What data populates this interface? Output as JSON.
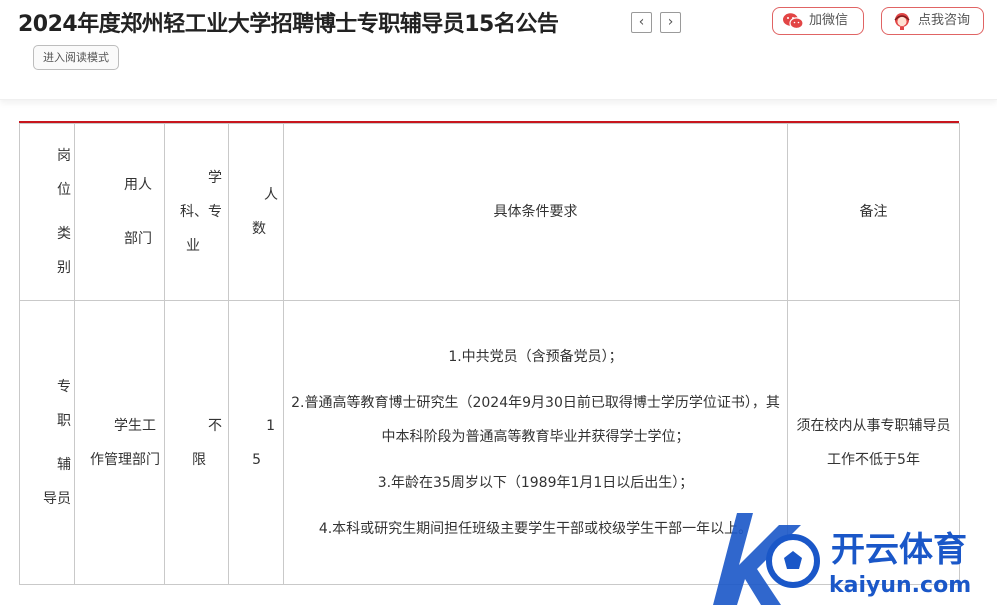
{
  "header": {
    "title": "2024年度郑州轻工业大学招聘博士专职辅导员15名公告",
    "prev_glyph": "‹",
    "next_glyph": "›",
    "reader_mode": "进入阅读模式",
    "wechat_label": "加微信",
    "consult_label": "点我咨询"
  },
  "table": {
    "headers": {
      "category": [
        "岗",
        "位",
        "类",
        "别"
      ],
      "department": [
        "用人",
        "部门"
      ],
      "major": [
        "学",
        "科、专",
        "业"
      ],
      "count": [
        "人",
        "数"
      ],
      "requirements": "具体条件要求",
      "remarks": "备注"
    },
    "row": {
      "category": [
        "专",
        "职",
        "辅",
        "导员"
      ],
      "department": [
        "学生工",
        "作管理部门"
      ],
      "major": [
        "不",
        "限"
      ],
      "count": [
        "1",
        "5"
      ],
      "requirements": [
        "1.中共党员（含预备党员）；",
        "2.普通高等教育博士研究生（2024年9月30日前已取得博士学历学位证书），其中本科阶段为普通高等教育毕业并获得学士学位；",
        "3.年龄在35周岁以下（1989年1月1日以后出生）；",
        "4.本科或研究生期间担任班级主要学生干部或校级学生干部一年以上。"
      ],
      "remarks": "须在校内从事专职辅导员工作不低于5年"
    }
  },
  "watermark": {
    "name": "开云体育",
    "domain": "kaiyun.com"
  },
  "colors": {
    "accent_red": "#c8151d",
    "pill_border": "#e06464",
    "watermark_blue": "#1a57c8"
  }
}
